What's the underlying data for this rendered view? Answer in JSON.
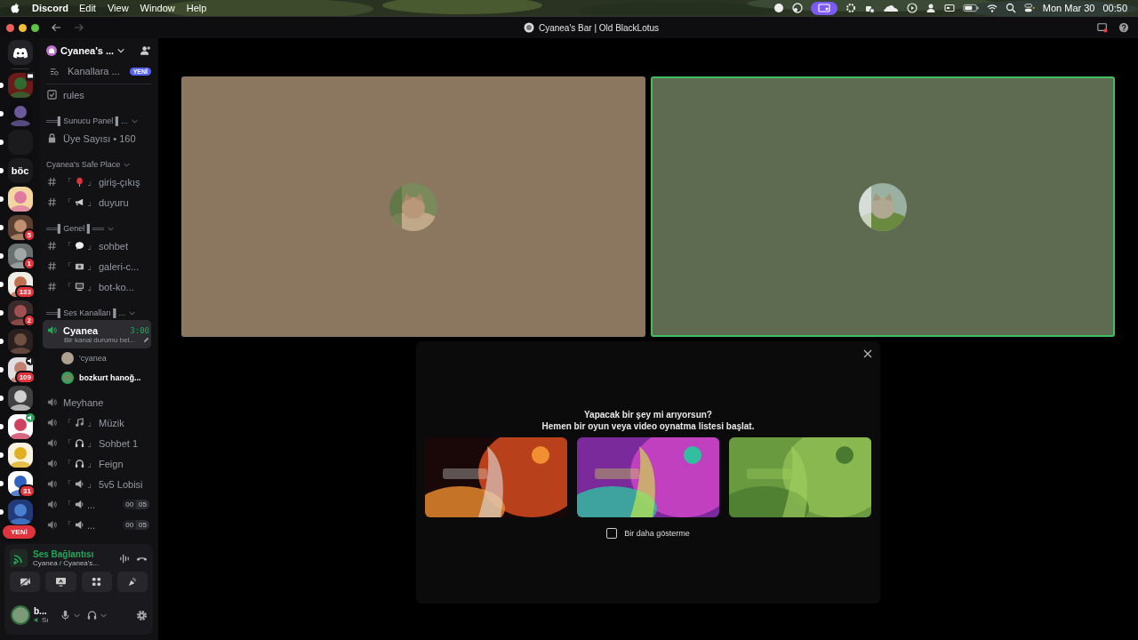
{
  "menubar": {
    "app": "Discord",
    "menus": [
      "Edit",
      "View",
      "Window",
      "Help"
    ],
    "date": "Mon Mar 30",
    "time": "00:50"
  },
  "window": {
    "title": "Cyanea's Bar | Old BlackLotus"
  },
  "servers": [
    {
      "kind": "home",
      "unread": false
    },
    {
      "kind": "picture",
      "unread": true,
      "status": {
        "kind": "screen"
      }
    },
    {
      "kind": "picture",
      "unread": true
    },
    {
      "kind": "picture",
      "unread": true
    },
    {
      "kind": "text",
      "label": "böc",
      "unread": true
    },
    {
      "kind": "picture",
      "unread": true
    },
    {
      "kind": "picture",
      "unread": true,
      "badge": "5"
    },
    {
      "kind": "picture",
      "unread": true,
      "badge": "1"
    },
    {
      "kind": "picture",
      "unread": true,
      "badge": "133"
    },
    {
      "kind": "picture",
      "unread": true,
      "badge": "2"
    },
    {
      "kind": "picture",
      "unread": true
    },
    {
      "kind": "picture",
      "unread": true,
      "badge": "109",
      "status": {
        "kind": "voice"
      }
    },
    {
      "kind": "picture",
      "unread": true
    },
    {
      "kind": "picture",
      "unread": true,
      "status": {
        "kind": "voice-live"
      }
    },
    {
      "kind": "picture",
      "unread": true
    },
    {
      "kind": "picture",
      "unread": true,
      "badge": "31"
    },
    {
      "kind": "picture",
      "unread": true
    }
  ],
  "rail_notice": "YENİ",
  "sidebar": {
    "server_name": "Cyanea's ...",
    "browse": {
      "label": "Kanallara ...",
      "badge": "YENİ"
    },
    "channels": [
      {
        "kind": "rules",
        "name": "rules",
        "selected": false
      },
      {
        "kind": "category",
        "name": "══▌Sunucu Panel ▌...",
        "expanded": true
      },
      {
        "kind": "locked",
        "name": "Üye Sayısı • 160",
        "selected": false
      },
      {
        "kind": "category",
        "name": "Cyanea's Safe Place",
        "expanded": true
      },
      {
        "kind": "text",
        "prefix": "「",
        "suffix": "」",
        "name": "giriş-çıkış",
        "selected": false
      },
      {
        "kind": "text",
        "prefix": "「",
        "suffix": "」",
        "name": "duyuru",
        "selected": false
      },
      {
        "kind": "category",
        "name": "══▌Genel ▌══",
        "expanded": true
      },
      {
        "kind": "text",
        "prefix": "「",
        "suffix": "」",
        "name": "sohbet",
        "selected": false
      },
      {
        "kind": "text",
        "prefix": "「",
        "suffix": "」",
        "name": "galeri-c...",
        "selected": false
      },
      {
        "kind": "text",
        "prefix": "「",
        "suffix": "」",
        "name": "bot-ko...",
        "selected": false
      },
      {
        "kind": "category",
        "name": "══▌Ses Kanalları ▌...",
        "expanded": true
      },
      {
        "kind": "voice",
        "name": "Cyanea",
        "selected": true,
        "timer": "3:00",
        "status": "Bir kanal durumu bel...",
        "children": [
          {
            "name": "'cyanea",
            "speaking": false
          },
          {
            "name": "bozkurt hanoğ...",
            "speaking": true
          }
        ]
      },
      {
        "kind": "voice",
        "name": "Meyhane",
        "selected": false
      },
      {
        "kind": "voice",
        "prefix": "「",
        "suffix": "」",
        "name": "Müzik",
        "selected": false
      },
      {
        "kind": "voice",
        "prefix": "「",
        "suffix": "」",
        "name": "Sohbet 1",
        "selected": false
      },
      {
        "kind": "voice",
        "prefix": "「",
        "suffix": "」",
        "name": "Feign",
        "selected": false
      },
      {
        "kind": "voice",
        "prefix": "「",
        "suffix": "」",
        "name": "5v5 Lobisi",
        "selected": false
      },
      {
        "kind": "voice",
        "prefix": "「",
        "name": "...",
        "selected": false,
        "limit": {
          "current": "00",
          "max": "05"
        }
      },
      {
        "kind": "voice",
        "prefix": "「",
        "name": "...",
        "selected": false,
        "limit": {
          "current": "00",
          "max": "05"
        }
      }
    ]
  },
  "voice_panel": {
    "status": "Ses Bağlantısı",
    "channel": "Cyanea / Cyanea's..."
  },
  "user": {
    "name": "b...",
    "status": "Sı"
  },
  "tiles": [
    {
      "color": "#8b7760",
      "speaking": false
    },
    {
      "color": "#5f6b50",
      "speaking": true
    }
  ],
  "prompt": {
    "lines": [
      "Yapacak bir şey mi arıyorsun?",
      "Hemen bir oyun veya video oynatma listesi başlat."
    ],
    "activities": [
      {
        "kind": "picture"
      },
      {
        "kind": "picture"
      },
      {
        "kind": "picture"
      }
    ],
    "dont_show": {
      "label": "Bir daha gösterme",
      "checked": false
    }
  }
}
